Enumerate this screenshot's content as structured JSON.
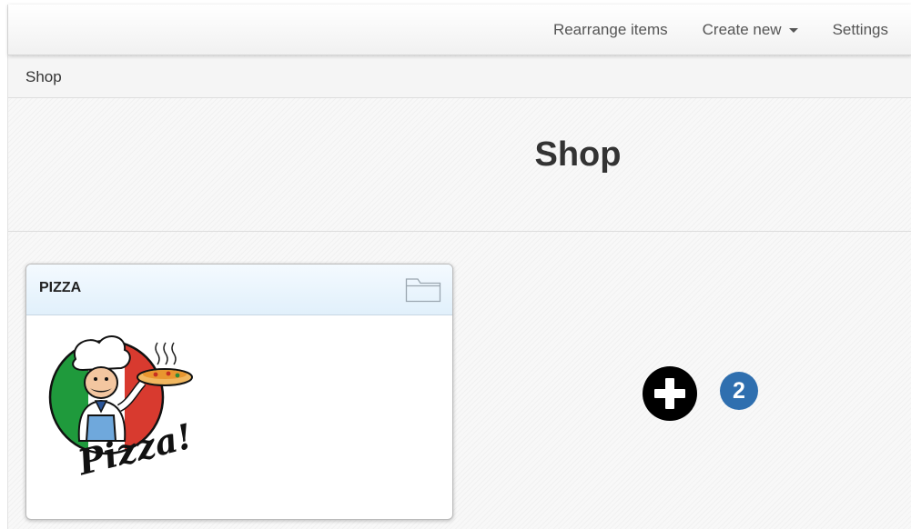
{
  "navbar": {
    "items": [
      {
        "label": "Rearrange items"
      },
      {
        "label": "Create new"
      },
      {
        "label": "Settings"
      }
    ]
  },
  "breadcrumb": {
    "current": "Shop"
  },
  "page": {
    "title": "Shop"
  },
  "card": {
    "title": "PIZZA",
    "icon": "folder-icon",
    "image_text": "Pizza!"
  },
  "add_button": {
    "icon": "plus-circle-icon"
  },
  "badge": {
    "count": "2",
    "color": "#2f6faf"
  }
}
